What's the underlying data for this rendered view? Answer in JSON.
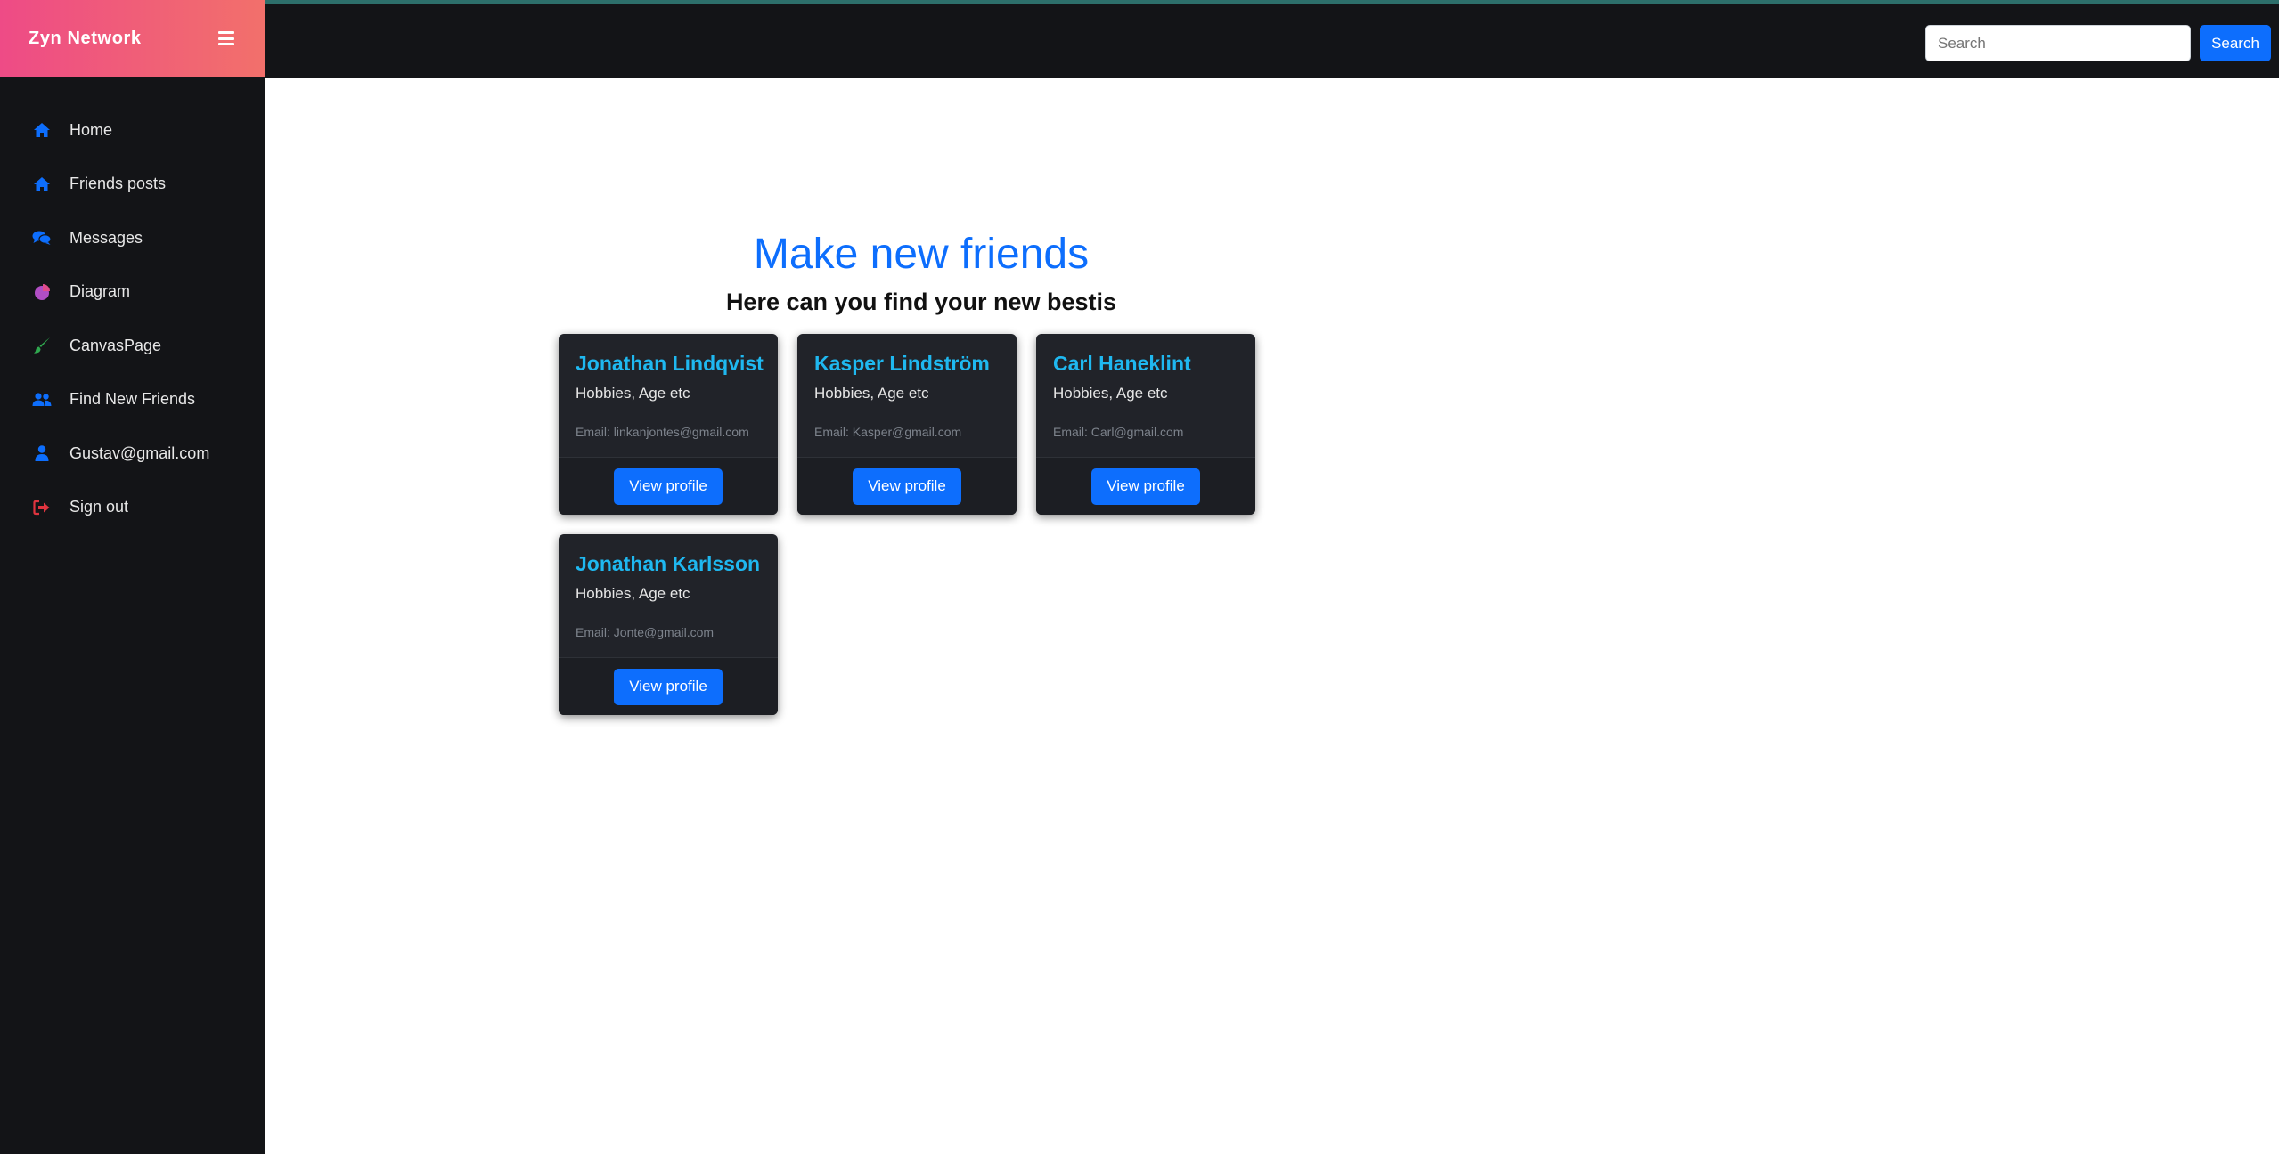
{
  "app": {
    "brand": "Zyn Network"
  },
  "sidebar": {
    "items": [
      {
        "label": "Home",
        "icon": "home-icon",
        "color": "#0d6efd"
      },
      {
        "label": "Friends posts",
        "icon": "home-icon",
        "color": "#0d6efd"
      },
      {
        "label": "Messages",
        "icon": "comments-icon",
        "color": "#0d6efd"
      },
      {
        "label": "Diagram",
        "icon": "pie-chart-icon",
        "color": "#b04ec4"
      },
      {
        "label": "CanvasPage",
        "icon": "paintbrush-icon",
        "color": "#2fa84f"
      },
      {
        "label": "Find New Friends",
        "icon": "users-icon",
        "color": "#0d6efd"
      },
      {
        "label": "Gustav@gmail.com",
        "icon": "user-icon",
        "color": "#0d6efd"
      },
      {
        "label": "Sign out",
        "icon": "sign-out-icon",
        "color": "#e0343f"
      }
    ]
  },
  "topbar": {
    "search_placeholder": "Search",
    "search_button": "Search"
  },
  "main": {
    "title": "Make new friends",
    "subtitle": "Here can you find your new bestis",
    "cards": [
      {
        "name": "Jonathan Lindqvist",
        "info": "Hobbies, Age etc",
        "email": "Email: linkanjontes@gmail.com",
        "button": "View profile"
      },
      {
        "name": "Kasper Lindström",
        "info": "Hobbies, Age etc",
        "email": "Email: Kasper@gmail.com",
        "button": "View profile"
      },
      {
        "name": "Carl Haneklint",
        "info": "Hobbies, Age etc",
        "email": "Email: Carl@gmail.com",
        "button": "View profile"
      },
      {
        "name": "Jonathan Karlsson",
        "info": "Hobbies, Age etc",
        "email": "Email: Jonte@gmail.com",
        "button": "View profile"
      }
    ]
  },
  "colors": {
    "accent": "#0d6efd",
    "card_name": "#1fb8f0",
    "dark_bg": "#131417",
    "card_bg": "#212329"
  }
}
